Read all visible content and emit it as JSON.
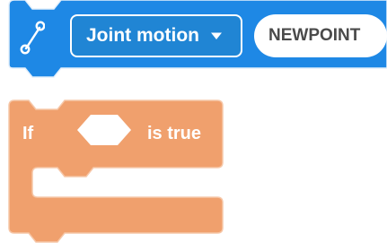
{
  "motion_block": {
    "icon": "joint-motion-icon",
    "dropdown_label": "Joint motion",
    "point_value": "NEWPOINT",
    "colors": {
      "block": "#1e88e5",
      "dropdown_fill": "#2085d4",
      "pill_fill": "#ffffff",
      "pill_text": "#4a4a4a"
    }
  },
  "if_block": {
    "if_label": "If",
    "true_label": "is true",
    "colors": {
      "block": "#f0a06d",
      "border": "#f6c7a8",
      "slot": "#ffffff"
    }
  }
}
